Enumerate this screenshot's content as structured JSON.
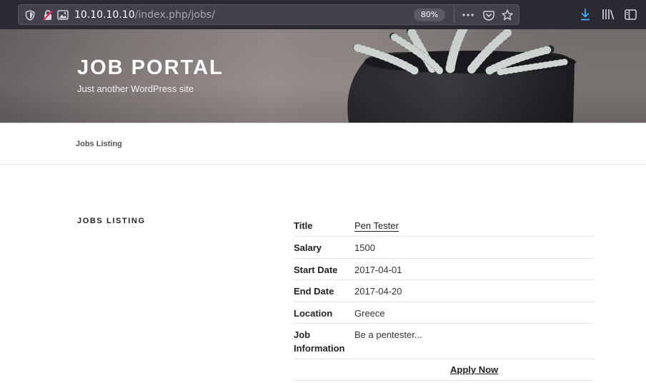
{
  "browser": {
    "url_host": "10.10.10.10",
    "url_path": "/index.php/jobs/",
    "zoom": "80%"
  },
  "site": {
    "title": "JOB PORTAL",
    "description": "Just another WordPress site"
  },
  "nav": {
    "items": [
      {
        "label": "Jobs Listing"
      }
    ]
  },
  "page": {
    "heading": "JOBS LISTING"
  },
  "job": {
    "rows": [
      {
        "label": "Title",
        "value": "Pen Tester"
      },
      {
        "label": "Salary",
        "value": "1500"
      },
      {
        "label": "Start Date",
        "value": "2017-04-01"
      },
      {
        "label": "End Date",
        "value": "2017-04-20"
      },
      {
        "label": "Location",
        "value": "Greece"
      },
      {
        "label": "Job Information",
        "value": "Be a pentester..."
      }
    ],
    "apply_label": "Apply Now"
  },
  "colors": {
    "toolbar_bg": "#2b2a33",
    "urlbar_bg": "#42414d",
    "download_icon": "#3fb2ff"
  },
  "icons": [
    "shield-icon",
    "insecure-lock-icon",
    "image-permission-icon",
    "more-actions-icon",
    "pocket-icon",
    "bookmark-star-icon",
    "download-icon",
    "library-icon",
    "sidebar-icon"
  ]
}
